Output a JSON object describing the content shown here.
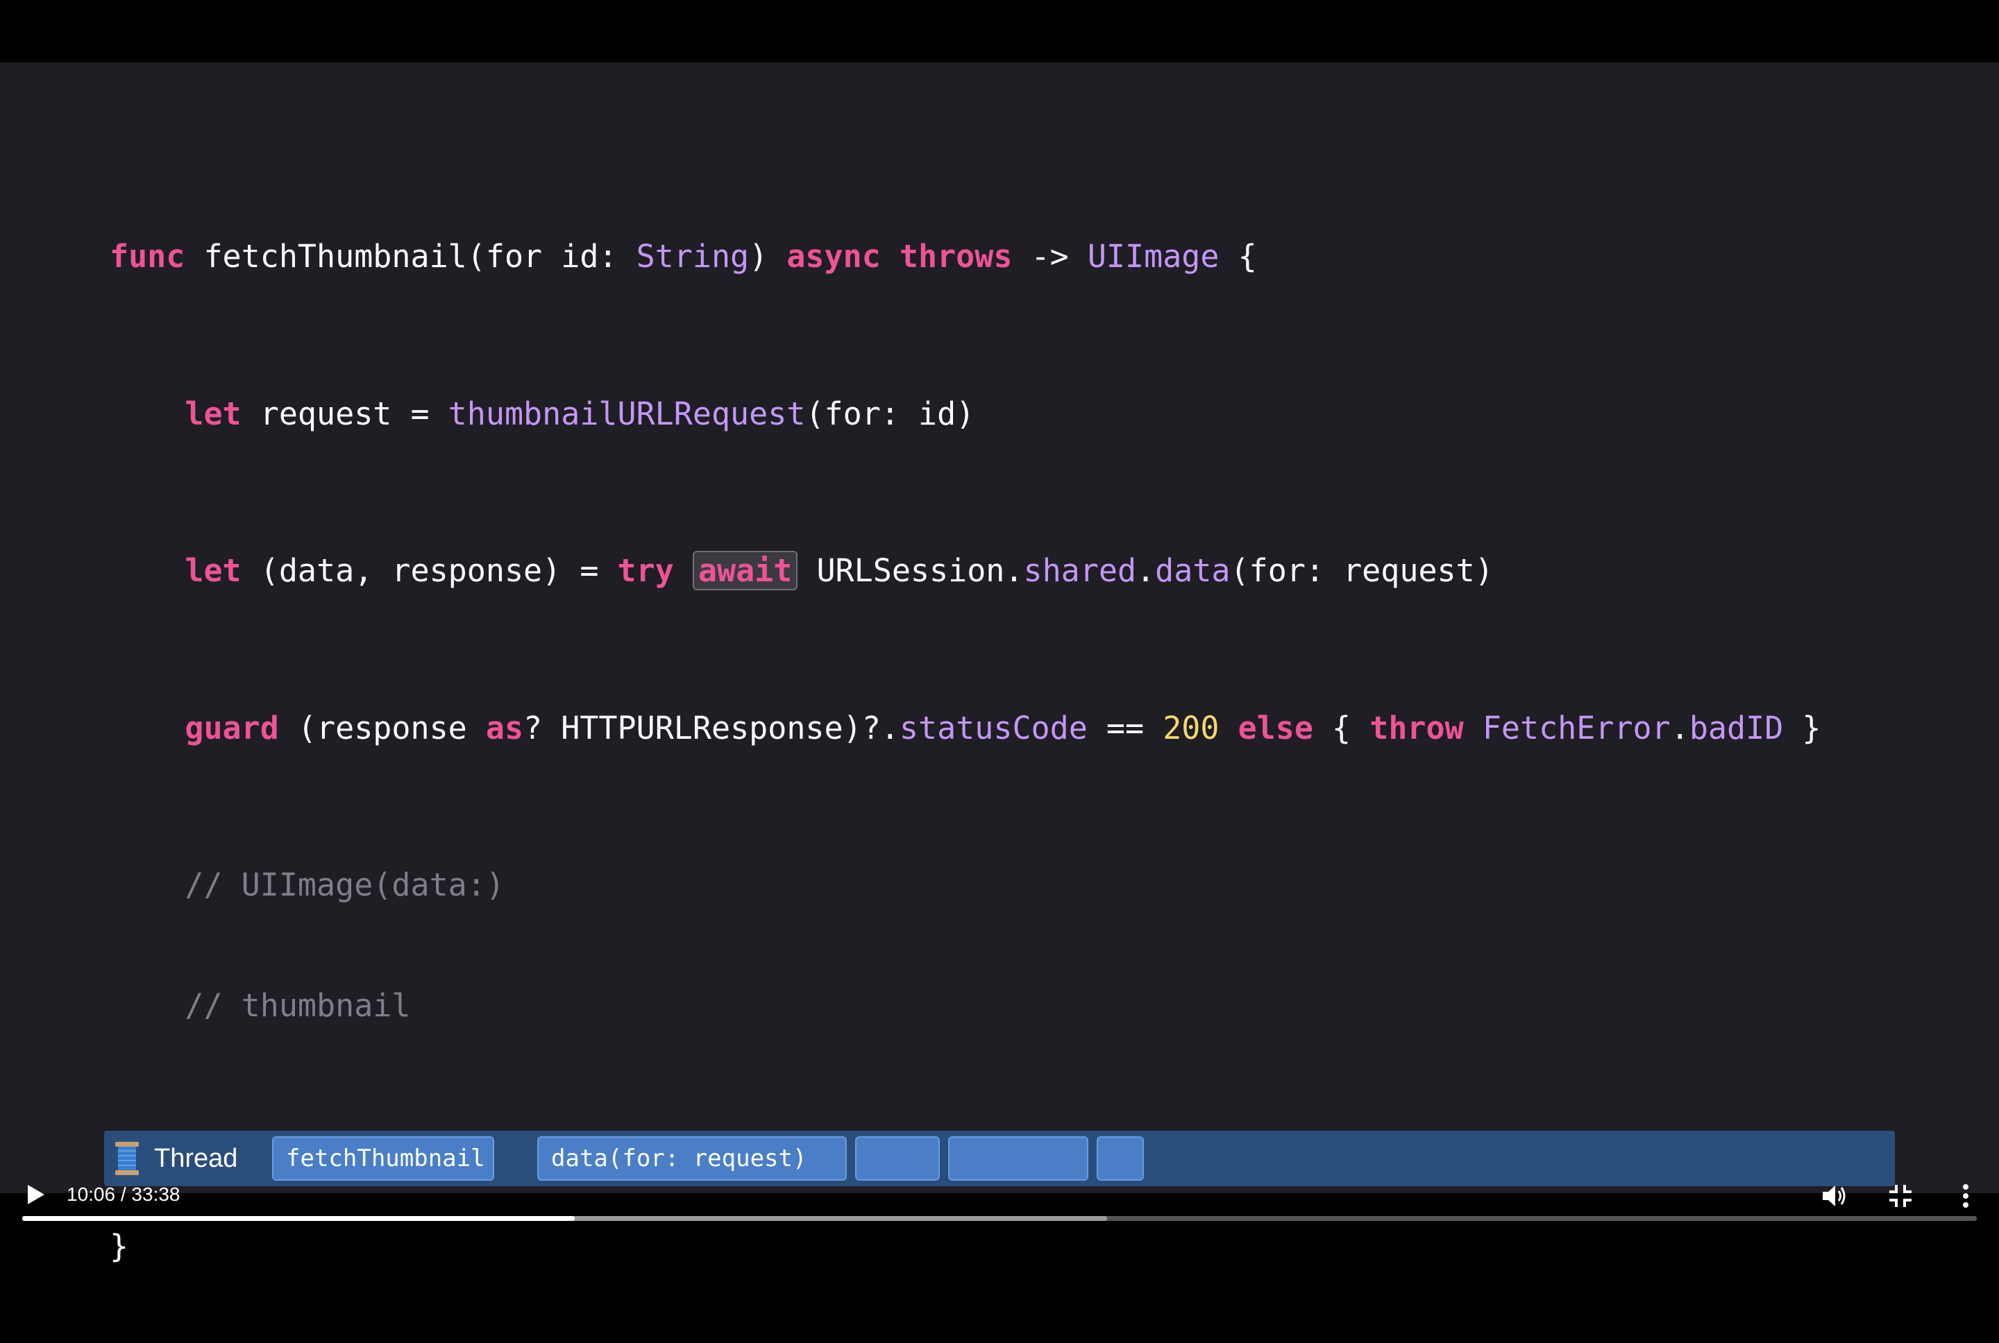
{
  "code": {
    "line1": {
      "kw_func": "func",
      "name": " fetchThumbnail(for id: ",
      "type_string": "String",
      "p1": ") ",
      "kw_async": "async",
      "sp1": " ",
      "kw_throws": "throws",
      "p2": " -> ",
      "type_uiimage": "UIImage",
      "p3": " {"
    },
    "line2": {
      "indent": "    ",
      "kw_let": "let",
      "p1": " request = ",
      "fn": "thumbnailURLRequest",
      "p2": "(for: id)"
    },
    "line3": {
      "indent": "    ",
      "kw_let": "let",
      "p1": " (data, response) = ",
      "kw_try": "try",
      "sp": " ",
      "kw_await": "await",
      "sp2": " ",
      "t1": "URLSession",
      "dot1": ".",
      "m1": "shared",
      "dot2": ".",
      "m2": "data",
      "p2": "(for: request)"
    },
    "line4": {
      "indent": "    ",
      "kw_guard": "guard",
      "p1": " (response ",
      "kw_as": "as",
      "p2": "? ",
      "t1": "HTTPURLResponse",
      "p3": ")?.",
      "m1": "statusCode",
      "p4": " == ",
      "num": "200",
      "sp": " ",
      "kw_else": "else",
      "p5": " { ",
      "kw_throw": "throw",
      "sp2": " ",
      "t2": "FetchError",
      "dot": ".",
      "m2": "badID",
      "p6": " }"
    },
    "line5": "    // UIImage(data:)",
    "line6": "    // thumbnail",
    "line8": "}"
  },
  "thread_bar": {
    "label": "Thread",
    "frames": [
      "fetchThumbnail",
      "data(for: request)",
      "",
      "",
      ""
    ]
  },
  "player": {
    "time": "10:06 / 33:38",
    "progress_played": 0.2825,
    "progress_buffered": 0.555
  },
  "colors": {
    "keyword": "#ee5396",
    "type": "#c497f5",
    "number": "#f5d76e",
    "comment": "#7d7f88",
    "background": "#1f1e24",
    "thread_bar": "#2a4e7c",
    "frame": "#4a7fc8"
  }
}
